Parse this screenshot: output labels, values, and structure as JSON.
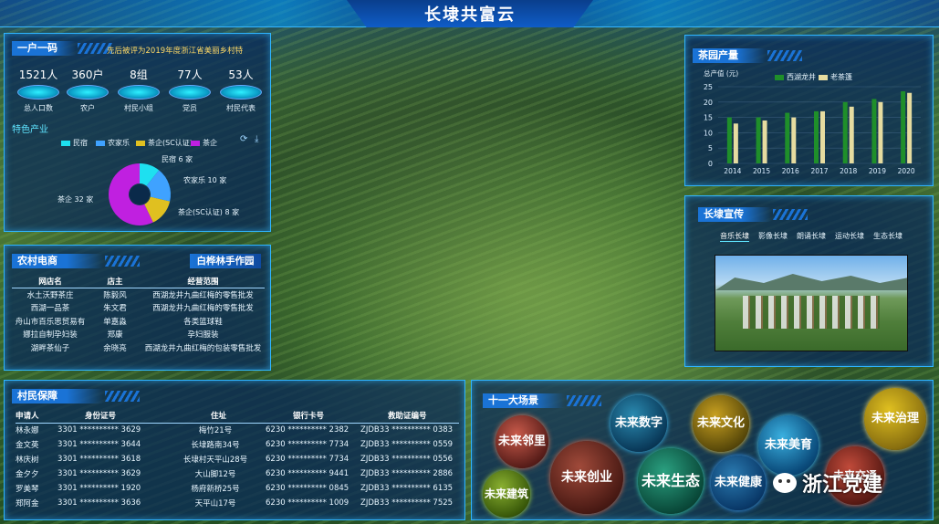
{
  "title": "长埭共富云",
  "yihu": {
    "title": "一户一码",
    "marquee": "先后被评为2019年度浙江省美丽乡村特",
    "stats": [
      {
        "value": "1521人",
        "label": "总人口数"
      },
      {
        "value": "360户",
        "label": "农户"
      },
      {
        "value": "8组",
        "label": "村民小组"
      },
      {
        "value": "77人",
        "label": "党员"
      },
      {
        "value": "53人",
        "label": "村民代表"
      }
    ],
    "industry_title": "特色产业",
    "legend": [
      {
        "name": "民宿",
        "color": "#1ee0f0"
      },
      {
        "name": "农家乐",
        "color": "#3fa2ff"
      },
      {
        "name": "茶企(SC认证)",
        "color": "#e0c020"
      },
      {
        "name": "茶企",
        "color": "#c020e0"
      }
    ],
    "pie_labels": {
      "minsu": "民宿 6 家",
      "nongjiale": "农家乐 10 家",
      "chaqi_sc": "茶企(SC认证) 8 家",
      "chaqi": "茶企 32 家"
    }
  },
  "pie_values": [
    6,
    10,
    8,
    32
  ],
  "ecommerce": {
    "title": "农村电商",
    "title2": "白桦林手作园",
    "headers": [
      "网店名",
      "店主",
      "经营范围"
    ],
    "rows": [
      [
        "水土沃野茶庄",
        "陈毅风",
        "西湖龙井九曲红梅的零售批发"
      ],
      [
        "西湖一品茶",
        "朱文君",
        "西湖龙井九曲红梅的零售批发"
      ],
      [
        "舟山市百乐思贸易有",
        "单嘉淼",
        "各类篮球鞋"
      ],
      [
        "娜拉自制孕妇装",
        "郑康",
        "孕妇服装"
      ],
      [
        "湖畔茶仙子",
        "余晓亮",
        "西湖龙井九曲红梅的包装零售批发"
      ]
    ]
  },
  "villager": {
    "title": "村民保障",
    "headers": [
      "申请人",
      "身份证号",
      "住址",
      "银行卡号",
      "救助证编号"
    ],
    "rows": [
      [
        "林永娜",
        "3301 ********** 3629",
        "梅竹21号",
        "6230 ********** 2382",
        "ZJDB33 ********** 0383"
      ],
      [
        "金文英",
        "3301 ********** 3644",
        "长埭路南34号",
        "6230 ********** 7734",
        "ZJDB33 ********** 0559"
      ],
      [
        "林庆树",
        "3301 ********** 3618",
        "长埭村天平山28号",
        "6230 ********** 7734",
        "ZJDB33 ********** 0556"
      ],
      [
        "金夕夕",
        "3301 ********** 3629",
        "大山脚12号",
        "6230 ********** 9441",
        "ZJDB33 ********** 2886"
      ],
      [
        "罗美琴",
        "3301 ********** 1920",
        "杨府新桥25号",
        "6230 ********** 0845",
        "ZJDB33 ********** 6135"
      ],
      [
        "郑阿金",
        "3301 ********** 3636",
        "天平山17号",
        "6230 ********** 1009",
        "ZJDB33 ********** 7525"
      ]
    ]
  },
  "tea": {
    "title": "茶园产量",
    "unit": "总产值 (元)",
    "legend": [
      "西湖龙井",
      "老茶篷"
    ]
  },
  "chart_data": {
    "type": "bar",
    "title": "茶园产量",
    "ylabel": "总产值 (元)",
    "categories": [
      "2014",
      "2015",
      "2016",
      "2017",
      "2018",
      "2019",
      "2020"
    ],
    "series": [
      {
        "name": "西湖龙井",
        "values": [
          15,
          15,
          16.5,
          17,
          20,
          21,
          23.5
        ]
      },
      {
        "name": "老茶篷",
        "values": [
          13,
          14,
          15,
          17,
          18.5,
          20,
          23
        ]
      }
    ],
    "ylim": [
      0,
      25
    ],
    "yticks": [
      "0",
      "5",
      "10",
      "15",
      "20",
      "25"
    ],
    "colors": [
      "#1f8f2a",
      "#e6dca0"
    ]
  },
  "promo": {
    "title": "长埭宣传",
    "tabs": [
      "音乐长埭",
      "影像长埭",
      "朗诵长埭",
      "运动长埭",
      "生态长埭"
    ]
  },
  "scenes": {
    "title": "十一大场景",
    "items": [
      "未来邻里",
      "未来数字",
      "未来文化",
      "未来治理",
      "未来美育",
      "未来创业",
      "未来生态",
      "未来健康",
      "未来建筑",
      "未来交通"
    ]
  },
  "watermark": "浙江党建"
}
